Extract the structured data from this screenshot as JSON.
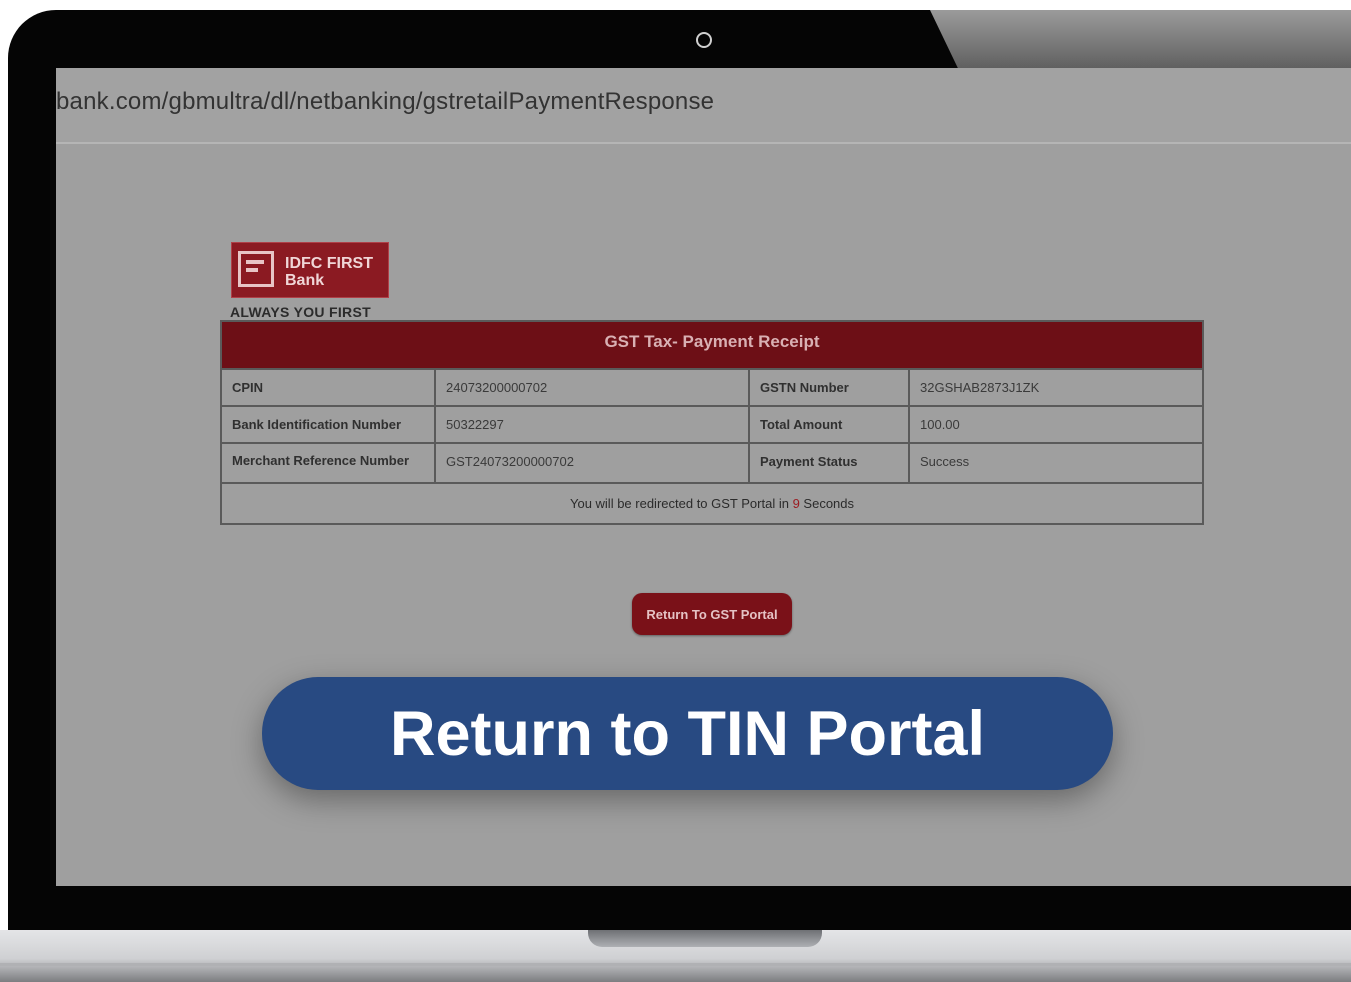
{
  "browser": {
    "url": "bank.com/gbmultra/dl/netbanking/gstretailPaymentResponse"
  },
  "brand": {
    "logo_line1": "IDFC FIRST",
    "logo_line2": "Bank",
    "tagline": "ALWAYS YOU FIRST",
    "logo_color": "#8b1a22"
  },
  "receipt": {
    "title": "GST Tax- Payment Receipt",
    "rows": [
      {
        "label_left": "CPIN",
        "value_left": "24073200000702",
        "label_right": "GSTN Number",
        "value_right": "32GSHAB2873J1ZK"
      },
      {
        "label_left": "Bank Identification Number",
        "value_left": "50322297",
        "label_right": "Total Amount",
        "value_right": "100.00"
      },
      {
        "label_left": "Merchant Reference Number",
        "value_left": "GST24073200000702",
        "label_right": "Payment Status",
        "value_right": "Success"
      }
    ],
    "redirect_prefix": "You will be redirected to GST Portal in",
    "redirect_seconds": "9",
    "redirect_suffix": "Seconds",
    "header_color": "#6d0f16"
  },
  "actions": {
    "return_gst": "Return To GST Portal",
    "return_tin": "Return to TIN Portal",
    "tin_color": "#284a82"
  }
}
